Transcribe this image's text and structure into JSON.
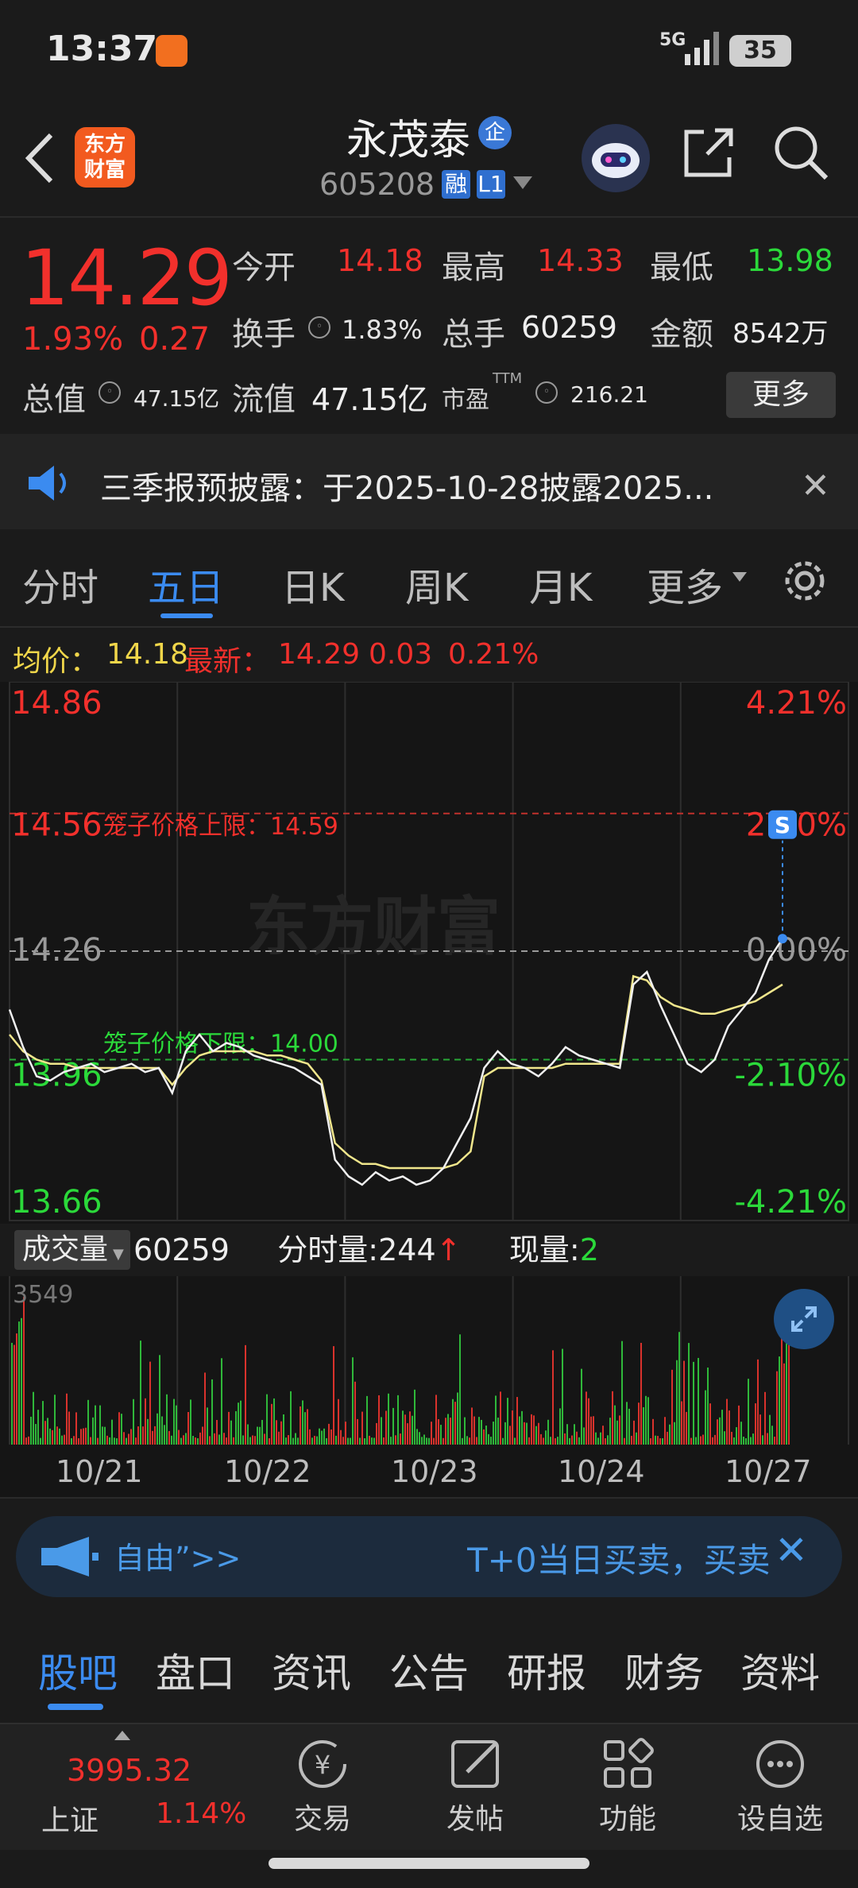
{
  "status_bar": {
    "time": "13:37",
    "network": "5G",
    "battery": "35"
  },
  "header": {
    "logo_text": "东方财富",
    "stock_name": "永茂泰",
    "badge_qi": "企",
    "code": "605208",
    "tag_rong": "融",
    "tag_level": "L1"
  },
  "quote": {
    "price": "14.29",
    "change_pct": "1.93%",
    "change": "0.27",
    "open_label": "今开",
    "open": "14.18",
    "high_label": "最高",
    "high": "14.33",
    "low_label": "最低",
    "low": "13.98",
    "turnover_label": "换手",
    "turnover": "1.83%",
    "volume_label": "总手",
    "volume": "60259",
    "amount_label": "金额",
    "amount": "8542万",
    "mktcap_label": "总值",
    "mktcap": "47.15亿",
    "float_label": "流值",
    "float": "47.15亿",
    "pe_label": "市盈",
    "pe_sup": "TTM",
    "pe": "216.21",
    "more": "更多"
  },
  "notice": {
    "text": "三季报预披露：于2025-10-28披露2025..."
  },
  "tabs": [
    "分时",
    "五日",
    "日K",
    "周K",
    "月K",
    "更多"
  ],
  "info_bar": {
    "avg_label": "均价：",
    "avg": "14.18",
    "latest_label": "最新：",
    "latest": "14.29",
    "latest_chg": "0.03",
    "latest_pct": "0.21%"
  },
  "chart_data": {
    "type": "line",
    "title": "",
    "x_categories": [
      "10/21",
      "10/22",
      "10/23",
      "10/24",
      "10/27"
    ],
    "y_left_ticks": [
      "14.86",
      "14.56",
      "14.26",
      "13.96",
      "13.66"
    ],
    "y_right_ticks": [
      "4.21%",
      "2.10%",
      "0.00%",
      "-2.10%",
      "-4.21%"
    ],
    "ylim": [
      13.66,
      14.86
    ],
    "cage_upper_label": "笼子价格上限：14.59",
    "cage_upper": 14.59,
    "cage_lower_label": "笼子价格下限：14.00",
    "cage_lower": 14.0,
    "prev_close": 14.26,
    "watermark": "东方财富",
    "marker": "S",
    "series": [
      {
        "name": "price",
        "values": [
          14.12,
          14.03,
          13.96,
          13.95,
          13.97,
          13.98,
          13.99,
          13.97,
          13.98,
          13.99,
          13.97,
          13.98,
          13.92,
          14.02,
          14.06,
          14.02,
          14.04,
          14.03,
          14.01,
          14.0,
          13.99,
          13.98,
          13.96,
          13.94,
          13.76,
          13.72,
          13.7,
          13.73,
          13.71,
          13.72,
          13.7,
          13.71,
          13.74,
          13.8,
          13.86,
          13.98,
          14.02,
          13.99,
          13.98,
          13.96,
          13.99,
          14.03,
          14.01,
          14.0,
          13.99,
          13.98,
          14.18,
          14.21,
          14.13,
          14.06,
          13.99,
          13.97,
          14.0,
          14.08,
          14.12,
          14.16,
          14.24,
          14.29
        ]
      },
      {
        "name": "avg",
        "values": [
          14.06,
          14.02,
          14.0,
          13.99,
          13.99,
          13.98,
          13.98,
          13.98,
          13.98,
          13.98,
          13.98,
          13.98,
          13.94,
          13.98,
          14.01,
          14.02,
          14.02,
          14.02,
          14.02,
          14.01,
          14.01,
          14.0,
          13.99,
          13.95,
          13.8,
          13.77,
          13.75,
          13.75,
          13.74,
          13.74,
          13.74,
          13.74,
          13.74,
          13.75,
          13.78,
          13.96,
          13.98,
          13.98,
          13.98,
          13.98,
          13.98,
          13.99,
          13.99,
          13.99,
          13.99,
          13.99,
          14.2,
          14.19,
          14.15,
          14.13,
          14.12,
          14.11,
          14.11,
          14.12,
          14.13,
          14.14,
          14.16,
          14.18
        ]
      }
    ],
    "volume": {
      "label": "成交量",
      "total": "60259",
      "tick_label": "分时量:244",
      "now_label": "现量:",
      "now": "2",
      "max_tick": "3549"
    }
  },
  "banner": {
    "left": "自由”>>",
    "right": "T+0当日买卖，买卖"
  },
  "sub_tabs": [
    "股吧",
    "盘口",
    "资讯",
    "公告",
    "研报",
    "财务",
    "资料"
  ],
  "bottom_nav": {
    "index_value": "3995.32",
    "index_name": "上证",
    "index_pct": "1.14%",
    "items": [
      "交易",
      "发帖",
      "功能",
      "设自选"
    ]
  },
  "colors": {
    "up": "#f2302c",
    "down": "#2bd93a",
    "accent": "#3b8bf0",
    "avg_line": "#f0e68c"
  }
}
